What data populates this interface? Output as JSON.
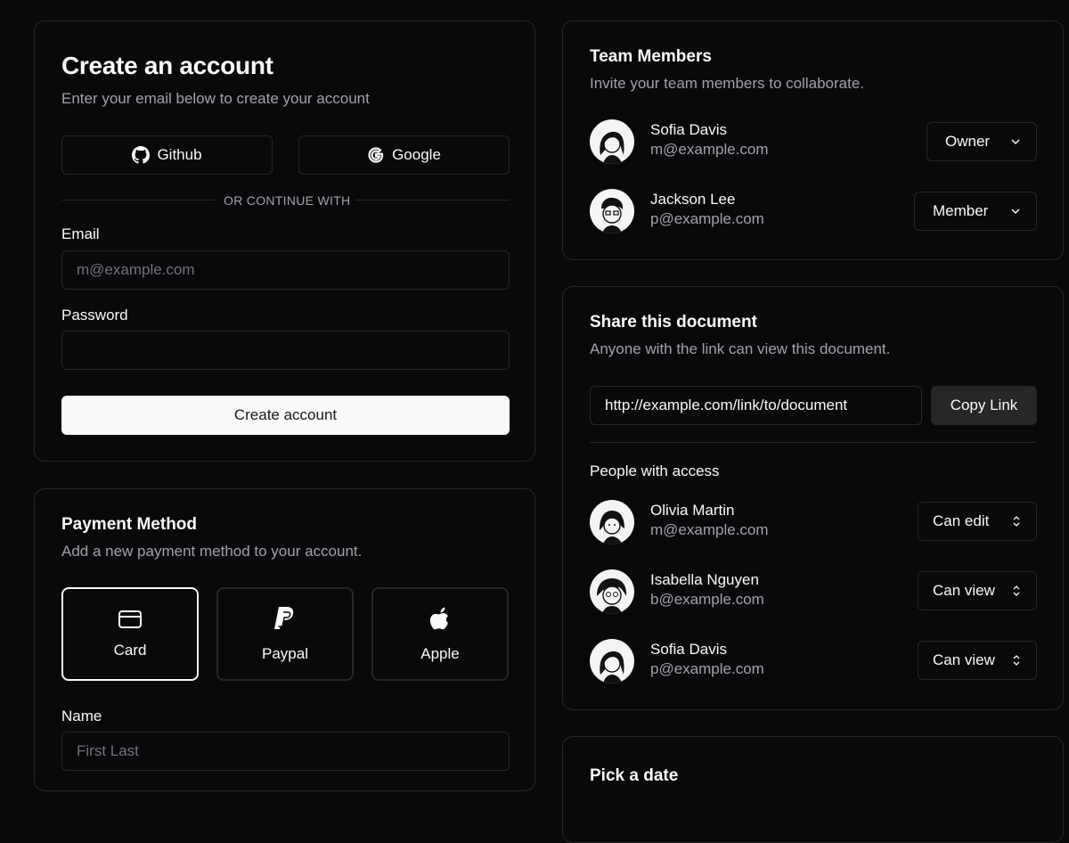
{
  "create_account": {
    "title": "Create an account",
    "subtitle": "Enter your email below to create your account",
    "github_label": "Github",
    "google_label": "Google",
    "divider_text": "OR CONTINUE WITH",
    "email_label": "Email",
    "email_placeholder": "m@example.com",
    "password_label": "Password",
    "password_value": "",
    "submit_label": "Create account"
  },
  "payment": {
    "title": "Payment Method",
    "subtitle": "Add a new payment method to your account.",
    "options": [
      {
        "label": "Card",
        "icon": "credit-card-icon",
        "selected": true
      },
      {
        "label": "Paypal",
        "icon": "paypal-icon",
        "selected": false
      },
      {
        "label": "Apple",
        "icon": "apple-icon",
        "selected": false
      }
    ],
    "name_label": "Name",
    "name_placeholder": "First Last"
  },
  "team": {
    "title": "Team Members",
    "subtitle": "Invite your team members to collaborate.",
    "members": [
      {
        "name": "Sofia Davis",
        "email": "m@example.com",
        "role": "Owner"
      },
      {
        "name": "Jackson Lee",
        "email": "p@example.com",
        "role": "Member"
      }
    ]
  },
  "share": {
    "title": "Share this document",
    "subtitle": "Anyone with the link can view this document.",
    "link": "http://example.com/link/to/document",
    "copy_label": "Copy Link",
    "people_heading": "People with access",
    "people": [
      {
        "name": "Olivia Martin",
        "email": "m@example.com",
        "access": "Can edit"
      },
      {
        "name": "Isabella Nguyen",
        "email": "b@example.com",
        "access": "Can view"
      },
      {
        "name": "Sofia Davis",
        "email": "p@example.com",
        "access": "Can view"
      }
    ]
  },
  "date_card": {
    "title": "Pick a date"
  },
  "colors": {
    "background": "#09090b",
    "border": "#27272a",
    "muted_text": "#a1a1aa",
    "primary": "#fafafa"
  }
}
